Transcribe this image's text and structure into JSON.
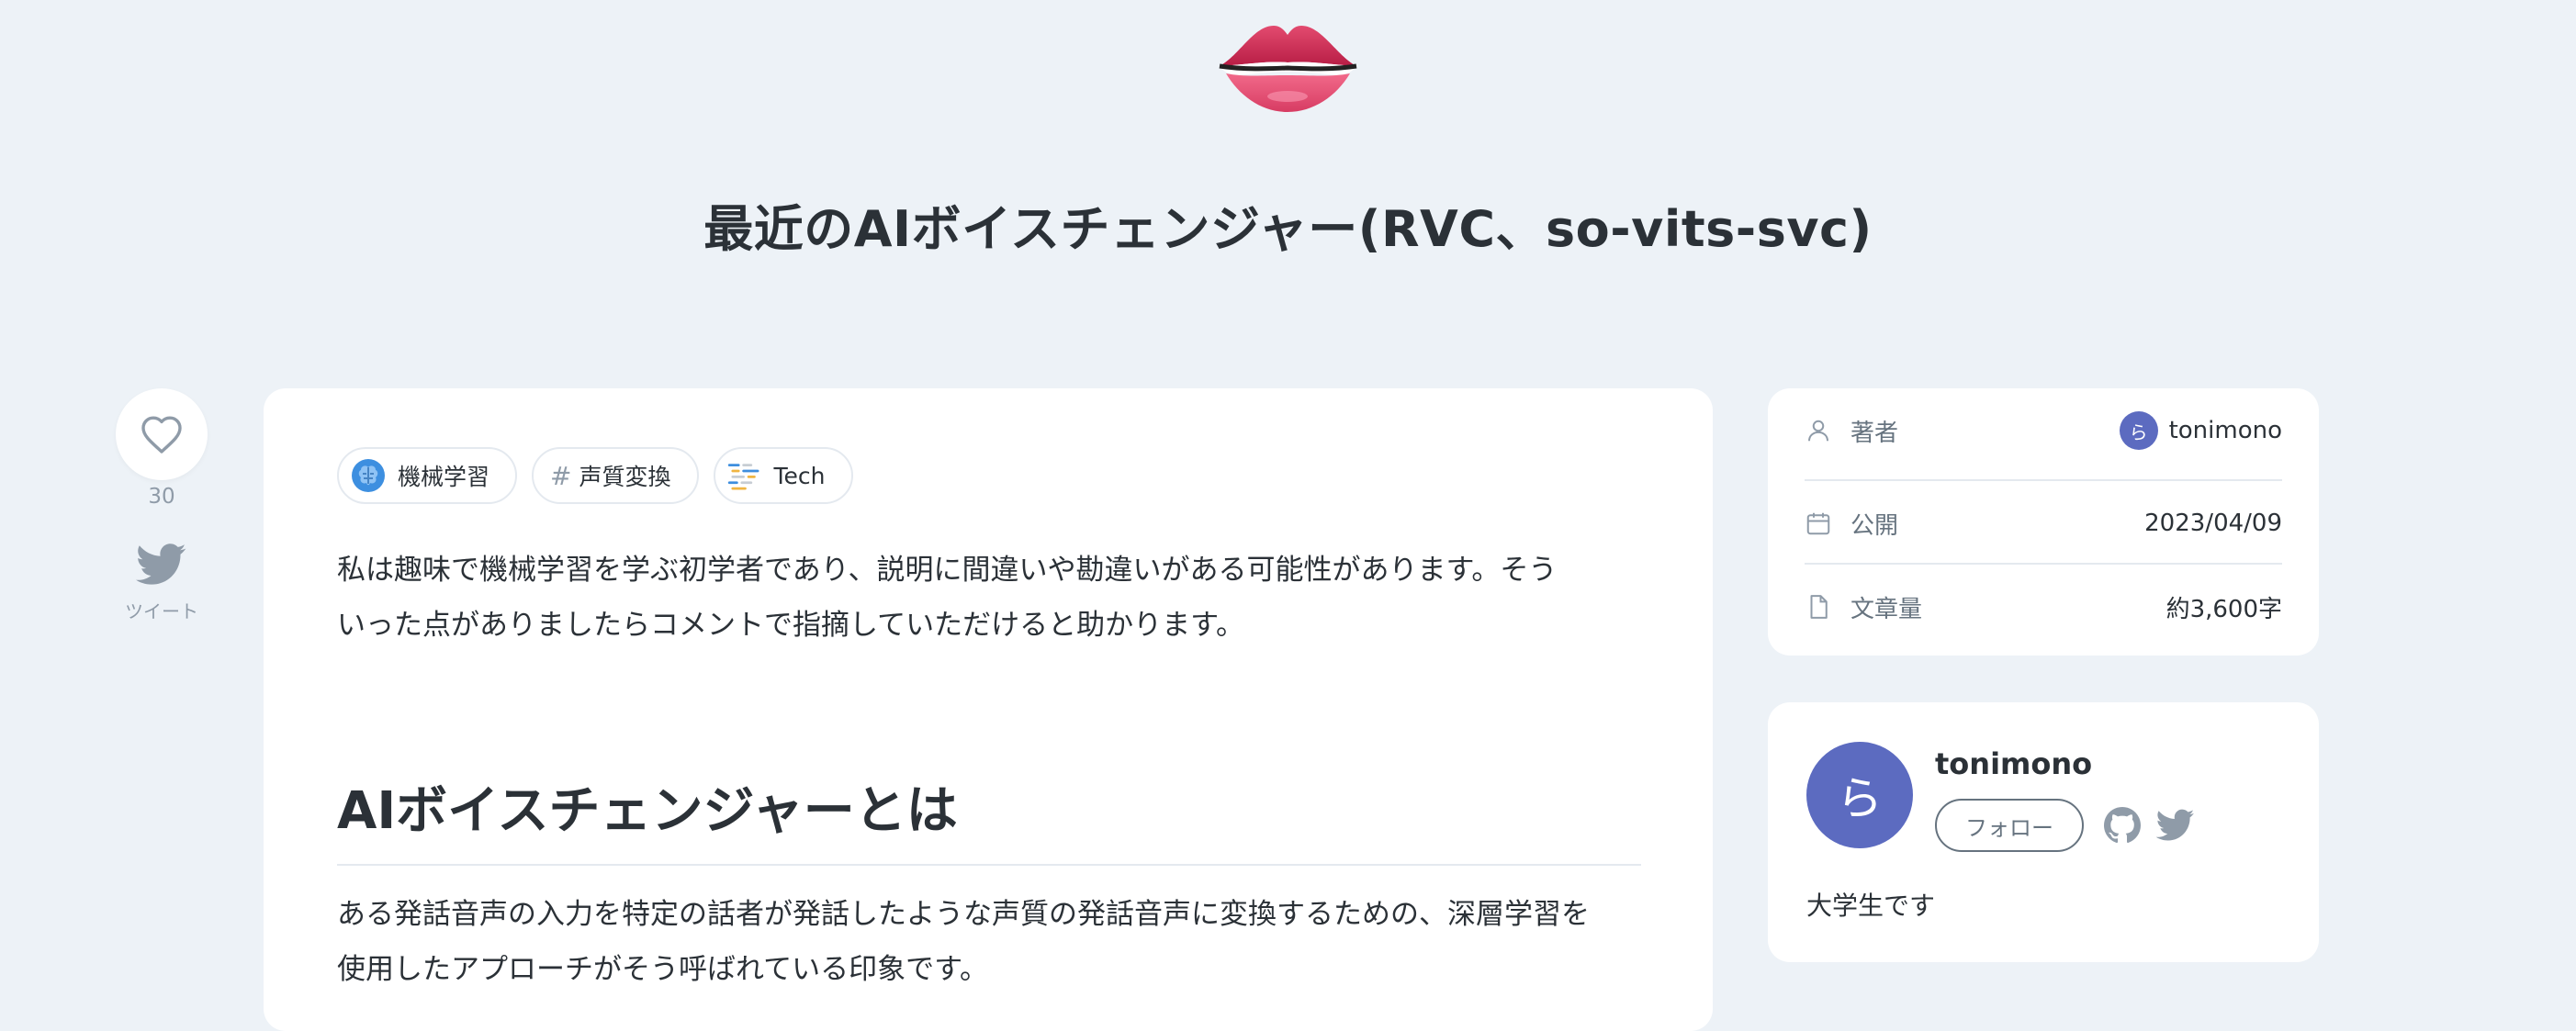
{
  "header": {
    "emoji": "lips-emoji",
    "title": "最近のAIボイスチェンジャー(RVC、so-vits-svc)"
  },
  "actions": {
    "like_count": "30",
    "tweet_label": "ツイート"
  },
  "article": {
    "topics": [
      {
        "label": "機械学習",
        "icon": "brain-icon"
      },
      {
        "label": "声質変換",
        "icon": "hash-icon"
      },
      {
        "label": "Tech",
        "icon": "code-lines-icon"
      }
    ],
    "intro_line1": "私は趣味で機械学習を学ぶ初学者であり、説明に間違いや勘違いがある可能性があります。そう",
    "intro_line2": "いった点がありましたらコメントで指摘していただけると助かります。",
    "heading": "AIボイスチェンジャーとは",
    "body_line1": "ある発話音声の入力を特定の話者が発話したような声質の発話音声に変換するための、深層学習を",
    "body_line2": "使用したアプローチがそう呼ばれている印象です。"
  },
  "info": {
    "author_key": "著者",
    "author_avatar": "ら",
    "author_val": "tonimono",
    "published_key": "公開",
    "published_val": "2023/04/09",
    "length_key": "文章量",
    "length_val": "約3,600字"
  },
  "author_card": {
    "avatar": "ら",
    "name": "tonimono",
    "follow_label": "フォロー",
    "bio": "大学生です"
  },
  "colors": {
    "background": "#edf2f7",
    "avatar": "#5c6bc0",
    "muted": "#8f9ba8"
  }
}
